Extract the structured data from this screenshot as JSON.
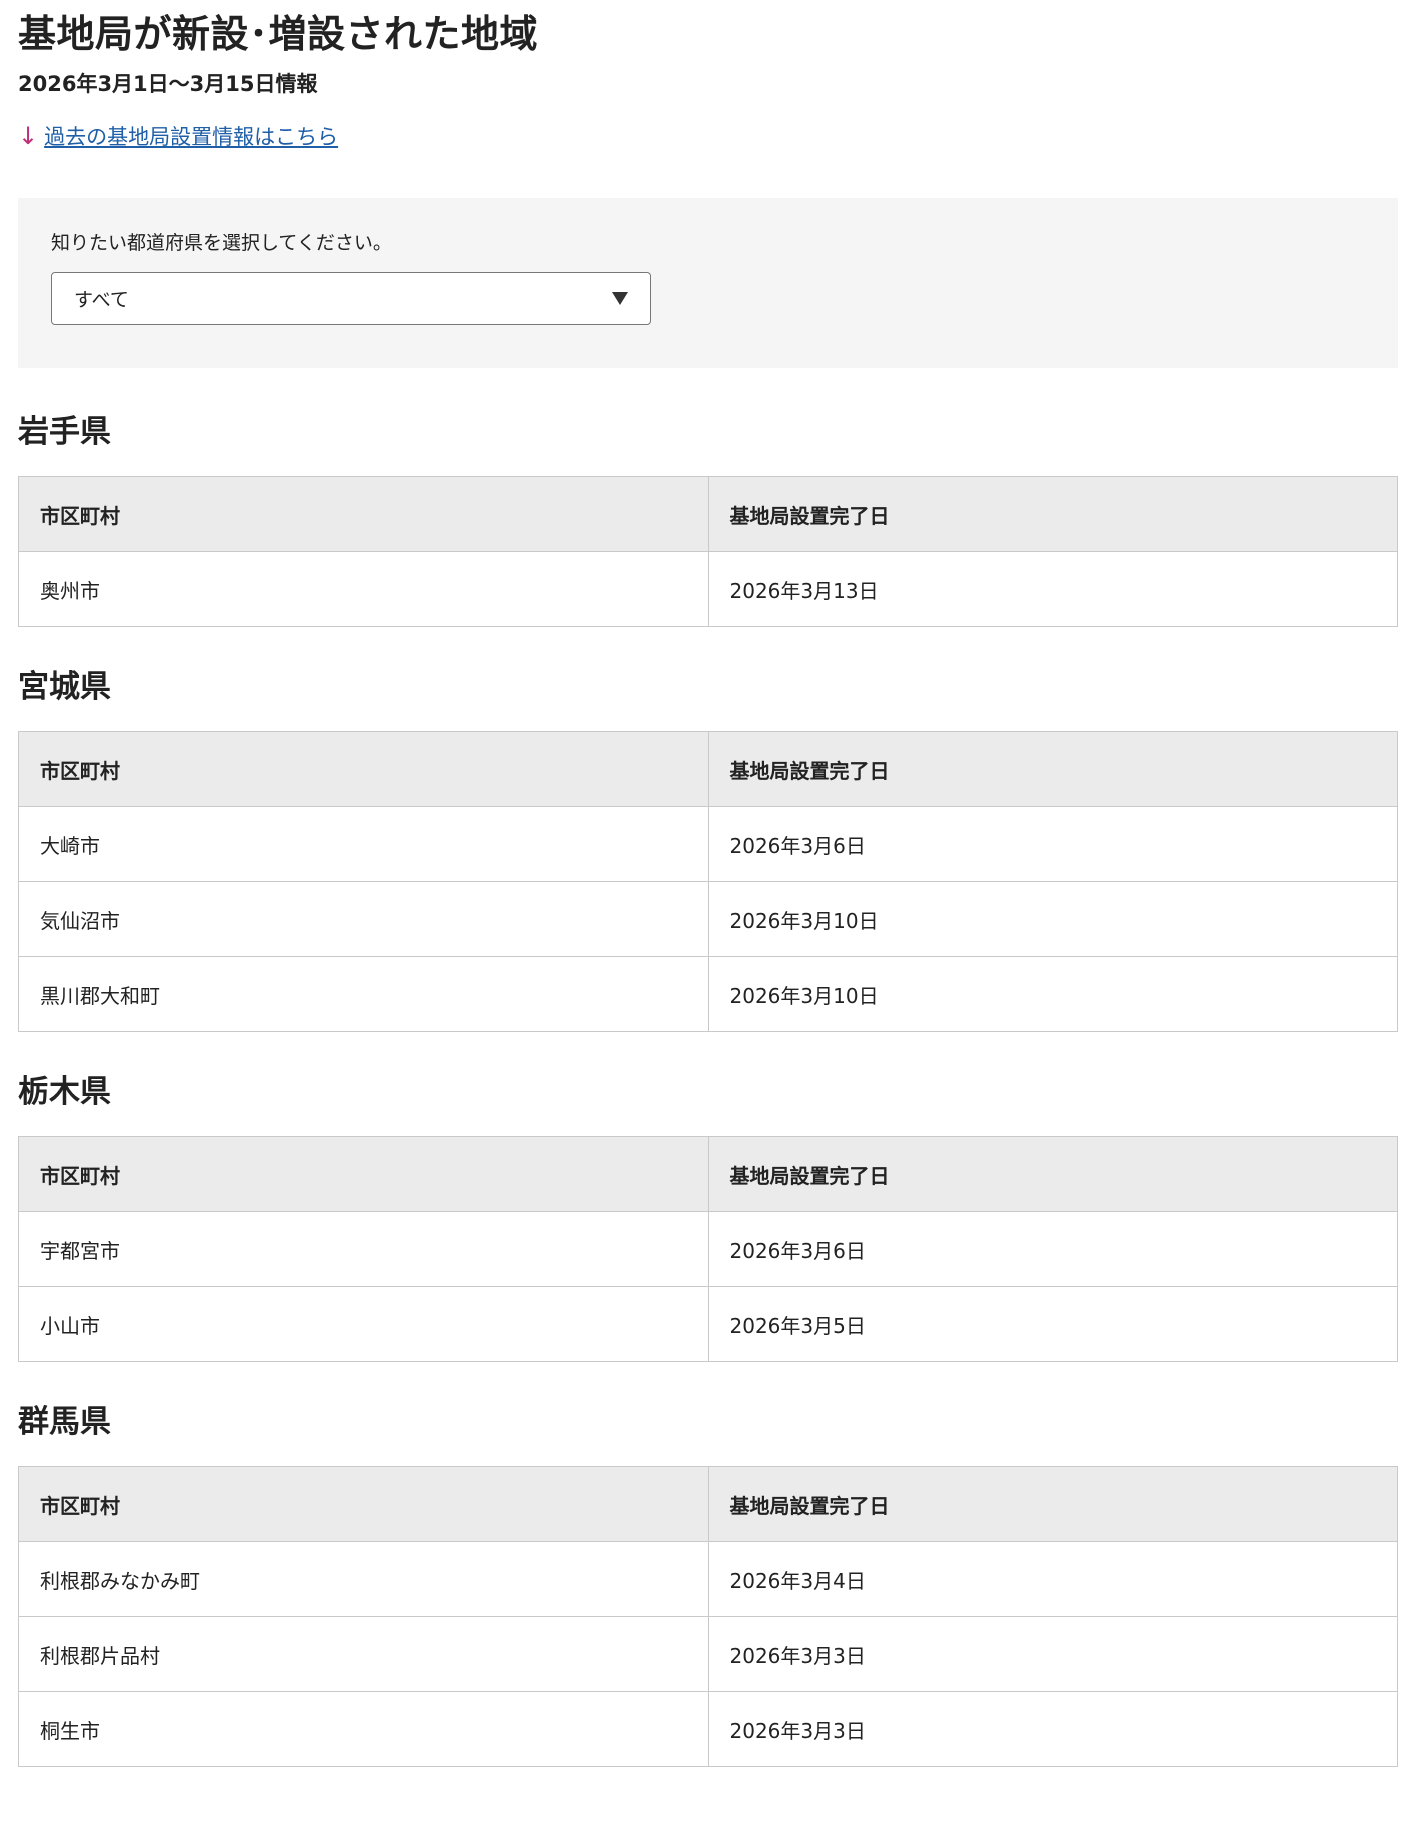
{
  "page": {
    "title": "基地局が新設･増設された地域",
    "period": "2026年3月1日〜3月15日情報",
    "past_link": {
      "icon": "arrow-down-icon",
      "label": "過去の基地局設置情報はこちら"
    }
  },
  "filter": {
    "label": "知りたい都道府県を選択してください。",
    "selected": "すべて"
  },
  "table_headers": {
    "city": "市区町村",
    "date": "基地局設置完了日"
  },
  "prefectures": [
    {
      "name": "岩手県",
      "rows": [
        {
          "city": "奥州市",
          "date": "2026年3月13日"
        }
      ]
    },
    {
      "name": "宮城県",
      "rows": [
        {
          "city": "大崎市",
          "date": "2026年3月6日"
        },
        {
          "city": "気仙沼市",
          "date": "2026年3月10日"
        },
        {
          "city": "黒川郡大和町",
          "date": "2026年3月10日"
        }
      ]
    },
    {
      "name": "栃木県",
      "rows": [
        {
          "city": "宇都宮市",
          "date": "2026年3月6日"
        },
        {
          "city": "小山市",
          "date": "2026年3月5日"
        }
      ]
    },
    {
      "name": "群馬県",
      "rows": [
        {
          "city": "利根郡みなかみ町",
          "date": "2026年3月4日"
        },
        {
          "city": "利根郡片品村",
          "date": "2026年3月3日"
        },
        {
          "city": "桐生市",
          "date": "2026年3月3日"
        }
      ]
    }
  ],
  "colors": {
    "link": "#1f5fa8",
    "arrow": "#c0307a",
    "header_bg": "#ebebeb",
    "filter_bg": "#f5f5f5"
  }
}
